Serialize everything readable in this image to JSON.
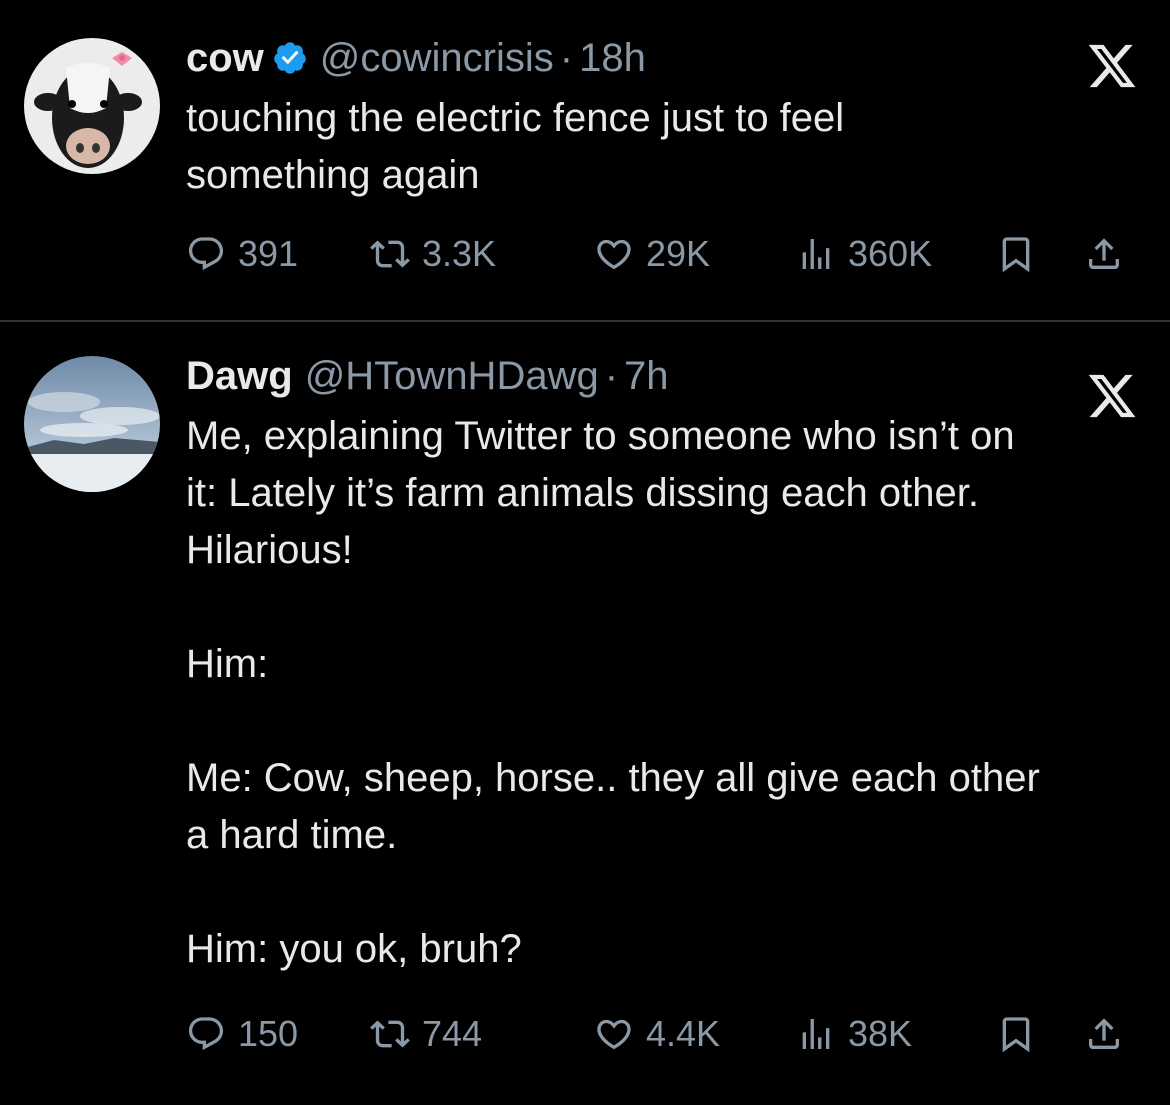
{
  "tweets": [
    {
      "name": "cow",
      "verified": true,
      "handle": "@cowincrisis",
      "dot": "·",
      "time": "18h",
      "text": "touching the electric fence just to feel\nsomething again",
      "replies": "391",
      "retweets": "3.3K",
      "likes": "29K",
      "views": "360K"
    },
    {
      "name": "Dawg",
      "verified": false,
      "handle": "@HTownHDawg",
      "dot": "·",
      "time": "7h",
      "text": "Me, explaining Twitter to someone who isn’t on\nit: Lately it’s farm animals dissing each other.\nHilarious!\n\nHim:\n\nMe: Cow, sheep, horse.. they all give each other\na hard time.\n\nHim: you ok, bruh?",
      "replies": "150",
      "retweets": "744",
      "likes": "4.4K",
      "views": "38K"
    }
  ],
  "colors": {
    "background": "#000000",
    "text": "#e7e9ea",
    "muted": "#8b98a5",
    "verified": "#1d9bf0",
    "divider": "#2f3336"
  },
  "icons": [
    "reply-icon",
    "retweet-icon",
    "like-icon",
    "views-icon",
    "bookmark-icon",
    "share-icon",
    "x-logo-icon",
    "verified-badge-icon"
  ]
}
